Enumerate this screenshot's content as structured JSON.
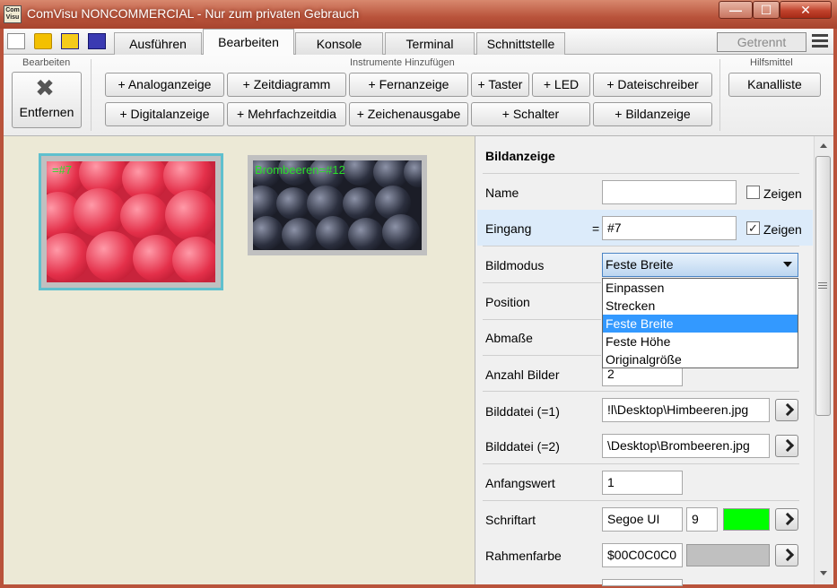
{
  "window": {
    "title": "ComVisu NONCOMMERCIAL - Nur zum privaten Gebrauch",
    "app_icon_text": "Com Visu",
    "min_glyph": "—",
    "max_glyph": "☐",
    "close_glyph": "✕"
  },
  "tabs": [
    {
      "label": "Ausführen"
    },
    {
      "label": "Bearbeiten",
      "active": true
    },
    {
      "label": "Konsole"
    },
    {
      "label": "Terminal"
    },
    {
      "label": "Schnittstelle"
    }
  ],
  "status": {
    "connection": "Getrennt"
  },
  "ribbon": {
    "group_edit": "Bearbeiten",
    "group_add": "Instrumente Hinzufügen",
    "group_tools": "Hilfsmittel",
    "remove_label": "Entfernen",
    "remove_glyph": "✖",
    "instruments_row1": [
      "+ Analoganzeige",
      "+ Zeitdiagramm",
      "+ Fernanzeige",
      "+ Taster",
      "+ LED",
      "+ Dateischreiber"
    ],
    "instruments_row2": [
      "+ Digitalanzeige",
      "+ Mehrfachzeitdia",
      "+ Zeichenausgabe",
      "+ Schalter",
      "+ Bildanzeige"
    ],
    "channel_list": "Kanalliste"
  },
  "canvas": {
    "image1_caption": "=#7",
    "image2_caption": "Brombeeren=#12"
  },
  "panel": {
    "title": "Bildanzeige",
    "name_label": "Name",
    "name_value": "",
    "name_show_label": "Zeigen",
    "name_show_checked": false,
    "input_label": "Eingang",
    "input_eq": "=",
    "input_value": "#7",
    "input_show_label": "Zeigen",
    "input_show_checked": true,
    "mode_label": "Bildmodus",
    "mode_value": "Feste Breite",
    "mode_options": [
      "Einpassen",
      "Strecken",
      "Feste Breite",
      "Feste Höhe",
      "Originalgröße"
    ],
    "mode_selected_index": 2,
    "position_label": "Position",
    "size_label": "Abmaße",
    "count_label": "Anzahl Bilder",
    "count_value": "2",
    "file1_label": "Bilddatei (=1)",
    "file1_value": "!l\\Desktop\\Himbeeren.jpg",
    "file2_label": "Bilddatei (=2)",
    "file2_value": "\\Desktop\\Brombeeren.jpg",
    "initial_label": "Anfangswert",
    "initial_value": "1",
    "font_label": "Schriftart",
    "font_value": "Segoe UI",
    "font_size": "9",
    "font_color": "#00ff00",
    "frame_color_label": "Rahmenfarbe",
    "frame_color_value": "$00C0C0C0",
    "frame_color_swatch": "#c0c0c0",
    "check_glyph": "✓"
  }
}
